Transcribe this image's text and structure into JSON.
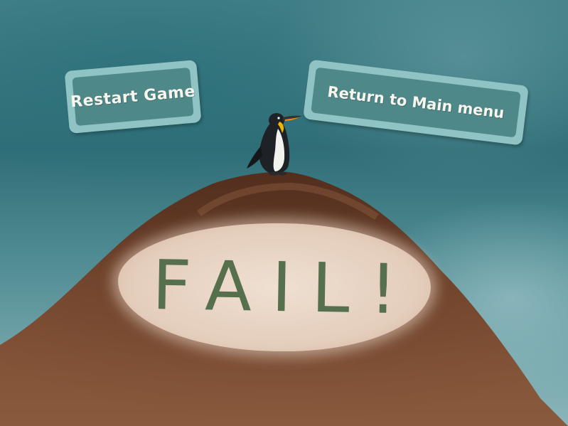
{
  "buttons": {
    "restart_label": "Restart Game",
    "menu_label": "Return to Main menu"
  },
  "result": {
    "text": "FAIL!"
  },
  "icons": {
    "player": "penguin-icon"
  },
  "colors": {
    "button_outer": "#8fc3c4",
    "button_inner": "#4f8888",
    "button_text": "#f6f6ee",
    "fail_text": "#56704d",
    "mountain": "#6b3d24",
    "sky": "#2f6e77"
  }
}
